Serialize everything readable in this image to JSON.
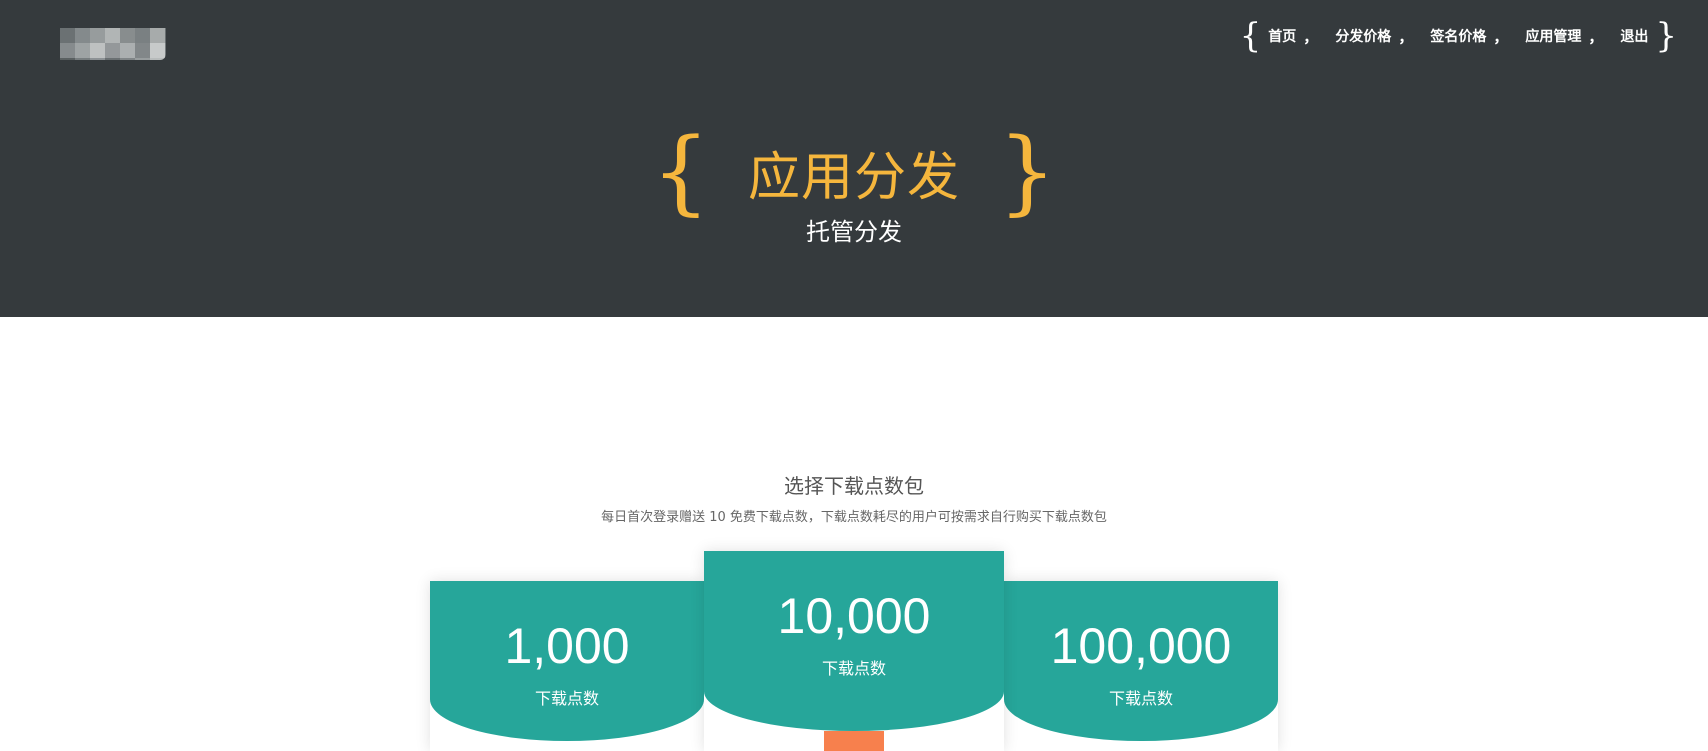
{
  "nav": {
    "items": [
      {
        "label": "首页"
      },
      {
        "label": "分发价格"
      },
      {
        "label": "签名价格"
      },
      {
        "label": "应用管理"
      },
      {
        "label": "退出"
      }
    ],
    "separator": "，",
    "brace_open": "{",
    "brace_close": "}"
  },
  "hero": {
    "brace_open": "{",
    "title": "应用分发",
    "brace_close": "}",
    "subtitle": "托管分发"
  },
  "packages": {
    "title": "选择下载点数包",
    "subtitle": "每日首次登录赠送 10 免费下载点数，下载点数耗尽的用户可按需求自行购买下载点数包",
    "cards": [
      {
        "amount": "1,000",
        "unit": "下载点数"
      },
      {
        "amount": "10,000",
        "unit": "下载点数"
      },
      {
        "amount": "100,000",
        "unit": "下载点数"
      }
    ]
  },
  "colors": {
    "header_bg": "#353a3d",
    "accent_gold": "#f5b63d",
    "card_teal": "#26a69a",
    "action_orange": "#f7804d"
  }
}
